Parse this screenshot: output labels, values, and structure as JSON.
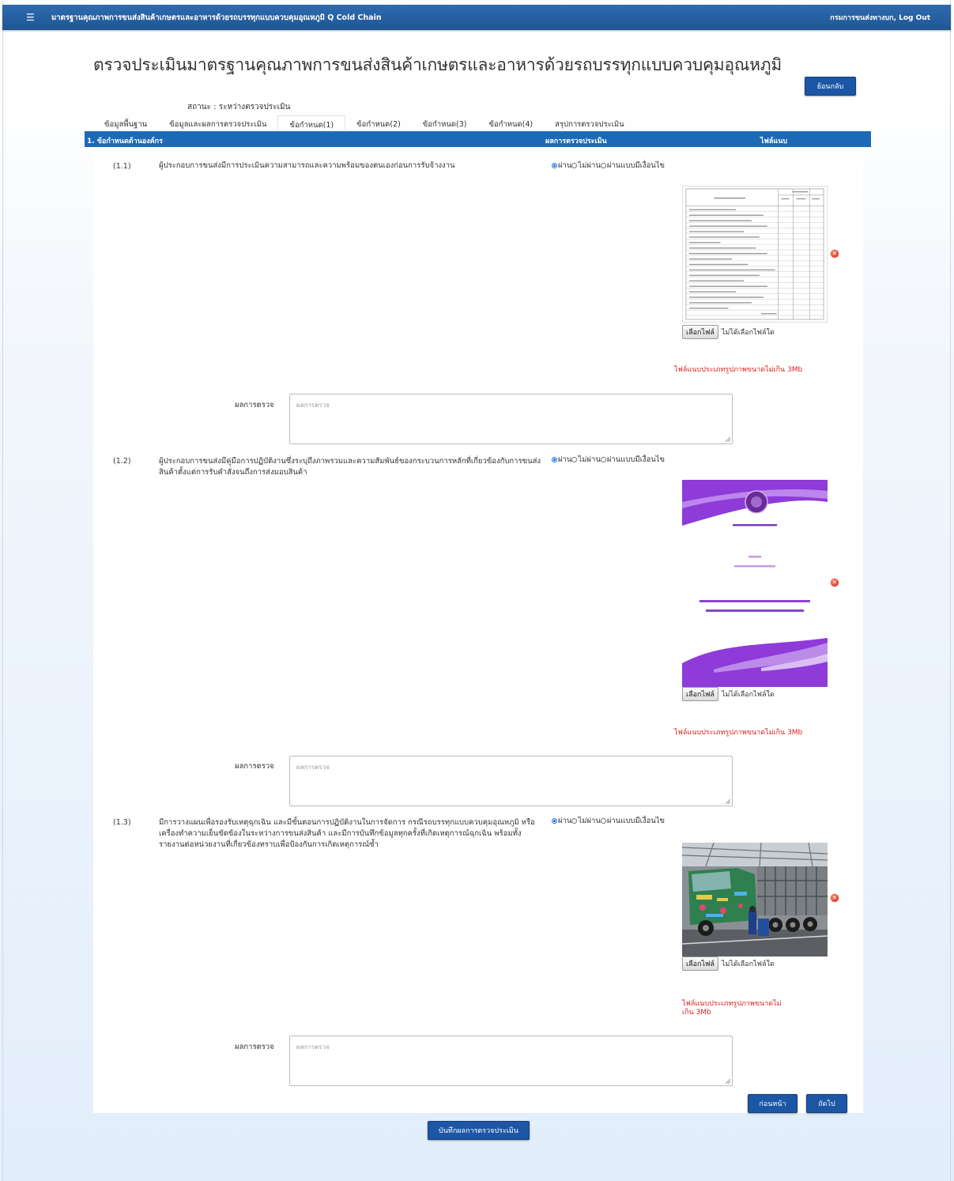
{
  "app": {
    "menu_icon": "hamburger-icon",
    "title": "มาตรฐานคุณภาพการขนส่งสินค้าเกษตรและอาหารด้วยรถบรรทุกแบบควบคุมอุณหภูมิ Q Cold Chain",
    "user": "กรมการขนส่งทางบก",
    "logout": "Log Out"
  },
  "page": {
    "title": "ตรวจประเมินมาตรฐานคุณภาพการขนส่งสินค้าเกษตรและอาหารด้วยรถบรรทุกแบบควบคุมอุณหภูมิ",
    "back_button": "ย้อนกลับ",
    "status": "สถานะ : ระหว่างตรวจประเมิน"
  },
  "tabs": [
    {
      "label": "ข้อมูลพื้นฐาน"
    },
    {
      "label": "ข้อมูลและผลการตรวจประเมิน"
    },
    {
      "label": "ข้อกำหนด(1)"
    },
    {
      "label": "ข้อกำหนด(2)"
    },
    {
      "label": "ข้อกำหนด(3)"
    },
    {
      "label": "ข้อกำหนด(4)"
    },
    {
      "label": "สรุปการตรวจประเมิน"
    }
  ],
  "active_tab": "ข้อกำหนด(1)",
  "section": {
    "title": "1. ข้อกำหนดด้านองค์กร",
    "col_result": "ผลการตรวจประเมิน",
    "col_attach": "ไฟล์แนบ"
  },
  "radio_options": {
    "pass": "ผ่าน",
    "fail": "ไม่ผ่าน",
    "conditional": "ผ่านแบบมีเงื่อนไข"
  },
  "file": {
    "choose": "เลือกไฟล์",
    "none": "ไม่ได้เลือกไฟล์ใด",
    "delete_icon": "delete-icon"
  },
  "items": [
    {
      "num": "(1.1)",
      "text": "ผู้ประกอบการขนส่งมีการประเมินความสามารถและความพร้อมของตนเองก่อนการรับจ้างงาน",
      "selected": "ผ่าน",
      "note": "ไฟล์แนบประเภทรูปภาพขนาดไม่เกิน 3Mb",
      "result_label": "ผลการตรวจ",
      "result_placeholder": "ผลการตรวจ"
    },
    {
      "num": "(1.2)",
      "text": "ผู้ประกอบการขนส่งมีคู่มือการปฏิบัติงานซึ่งระบุถึงภาพรวมและความสัมพันธ์ของกระบวนการหลักที่เกี่ยวข้องกับการขนส่งสินค้าตั้งแต่การรับคำสั่งจนถึงการส่งมอบสินค้า",
      "selected": "ผ่าน",
      "note": "ไฟล์แนบประเภทรูปภาพขนาดไม่เกิน 3Mb",
      "result_label": "ผลการตรวจ",
      "result_placeholder": "ผลการตรวจ"
    },
    {
      "num": "(1.3)",
      "text": "มีการวางแผนเพื่อรองรับเหตุฉุกเฉิน และมีขั้นตอนการปฏิบัติงานในการจัดการ กรณีรถบรรทุกแบบควบคุมอุณหภูมิ หรือเครื่องทำความเย็นขัดข้องในระหว่างการขนส่งสินค้า และมีการบันทึกข้อมูลทุกครั้งที่เกิดเหตุการณ์ฉุกเฉิน พร้อมทั้งรายงานต่อหน่วยงานที่เกี่ยวข้องทราบเพื่อป้องกันการเกิดเหตุการณ์ซ้ำ",
      "selected": "ผ่าน",
      "note": "ไฟล์แนบประเภทรูปภาพขนาดไม่เกิน 3Mb",
      "result_label": "ผลการตรวจ",
      "result_placeholder": "ผลการตรวจ"
    }
  ],
  "nav": {
    "prev": "ก่อนหน้า",
    "next": "ถัดไป",
    "save": "บันทึกผลการตรวจประเมิน"
  },
  "colors": {
    "header_blue": "#1c6ab7",
    "button_blue": "#1c57a5",
    "note_red": "#e02020",
    "purple": "#8a2be2"
  }
}
